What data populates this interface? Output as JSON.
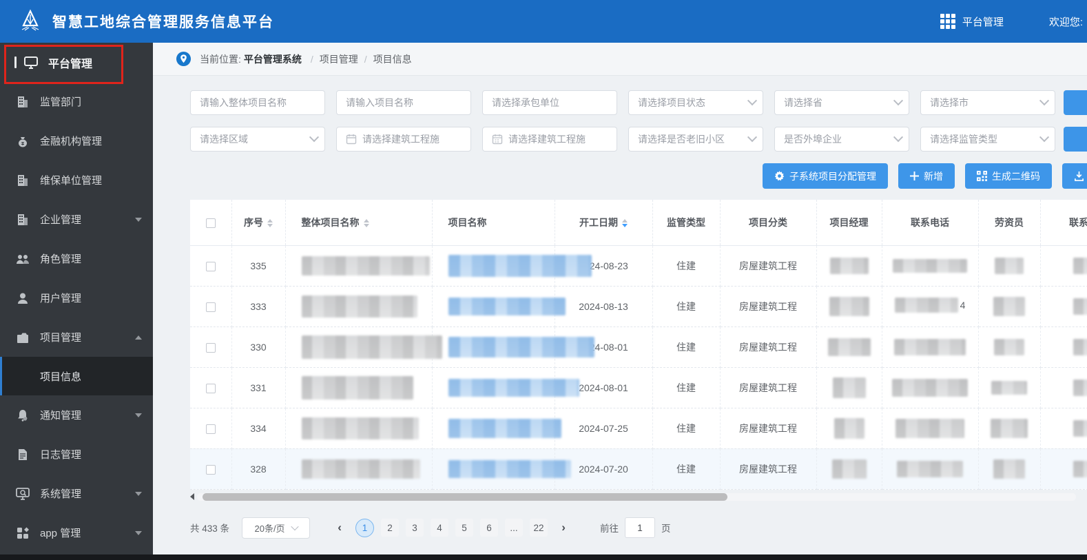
{
  "app": {
    "title": "智慧工地综合管理服务信息平台"
  },
  "topbar": {
    "platform_label": "平台管理",
    "welcome": "欢迎您:"
  },
  "sidebar": {
    "items": [
      {
        "label": "平台管理"
      },
      {
        "label": "监管部门"
      },
      {
        "label": "金融机构管理"
      },
      {
        "label": "维保单位管理"
      },
      {
        "label": "企业管理"
      },
      {
        "label": "角色管理"
      },
      {
        "label": "用户管理"
      },
      {
        "label": "项目管理"
      },
      {
        "label": "通知管理"
      },
      {
        "label": "日志管理"
      },
      {
        "label": "系统管理"
      },
      {
        "label": "app 管理"
      }
    ],
    "submenu_active": "项目信息"
  },
  "breadcrumb": {
    "prefix": "当前位置:",
    "root": "平台管理系统",
    "separator": "/",
    "level1": "项目管理",
    "level2": "项目信息"
  },
  "filters": {
    "overall_project_name": "请输入整体项目名称",
    "project_name": "请输入项目名称",
    "contractor": "请选择承包单位",
    "project_status": "请选择项目状态",
    "province": "请选择省",
    "city": "请选择市",
    "region": "请选择区域",
    "construction_date_start": "请选择建筑工程施",
    "construction_date_end": "请选择建筑工程施",
    "old_community": "请选择是否老旧小区",
    "foreign_enterprise": "是否外埠企业",
    "supervision_type": "请选择监管类型"
  },
  "actions": {
    "subsystem_assign": "子系统项目分配管理",
    "add": "新增",
    "generate_qrcode": "生成二维码",
    "download": "下载"
  },
  "table": {
    "columns": {
      "seq": "序号",
      "overall_name": "整体项目名称",
      "project_name": "项目名称",
      "start_date": "开工日期",
      "supervision_type": "监管类型",
      "category": "项目分类",
      "manager": "项目经理",
      "phone": "联系电话",
      "labor_officer": "劳资员",
      "phone2": "联系电话"
    },
    "rows": [
      {
        "seq": "335",
        "start_date": "2024-08-23",
        "supervision_type": "住建",
        "category": "房屋建筑工程",
        "phone_visible": ""
      },
      {
        "seq": "333",
        "start_date": "2024-08-13",
        "supervision_type": "住建",
        "category": "房屋建筑工程",
        "phone_visible": "4"
      },
      {
        "seq": "330",
        "start_date": "2024-08-01",
        "supervision_type": "住建",
        "category": "房屋建筑工程",
        "phone_visible": ""
      },
      {
        "seq": "331",
        "start_date": "2024-08-01",
        "supervision_type": "住建",
        "category": "房屋建筑工程",
        "phone_visible": ""
      },
      {
        "seq": "334",
        "start_date": "2024-07-25",
        "supervision_type": "住建",
        "category": "房屋建筑工程",
        "phone_visible": ""
      },
      {
        "seq": "328",
        "start_date": "2024-07-20",
        "supervision_type": "住建",
        "category": "房屋建筑工程",
        "phone_visible": ""
      }
    ]
  },
  "pagination": {
    "total": "共 433 条",
    "page_size": "20条/页",
    "pages": [
      "1",
      "2",
      "3",
      "4",
      "5",
      "6",
      "...",
      "22"
    ],
    "active_page": "1",
    "jump_prefix": "前往",
    "jump_value": "1",
    "jump_suffix": "页"
  },
  "colors": {
    "topbar_blue": "#1a6cc3",
    "button_blue": "#3d95e8",
    "highlight_red": "#e0241b",
    "active_page_blue": "#3a8ee6"
  }
}
